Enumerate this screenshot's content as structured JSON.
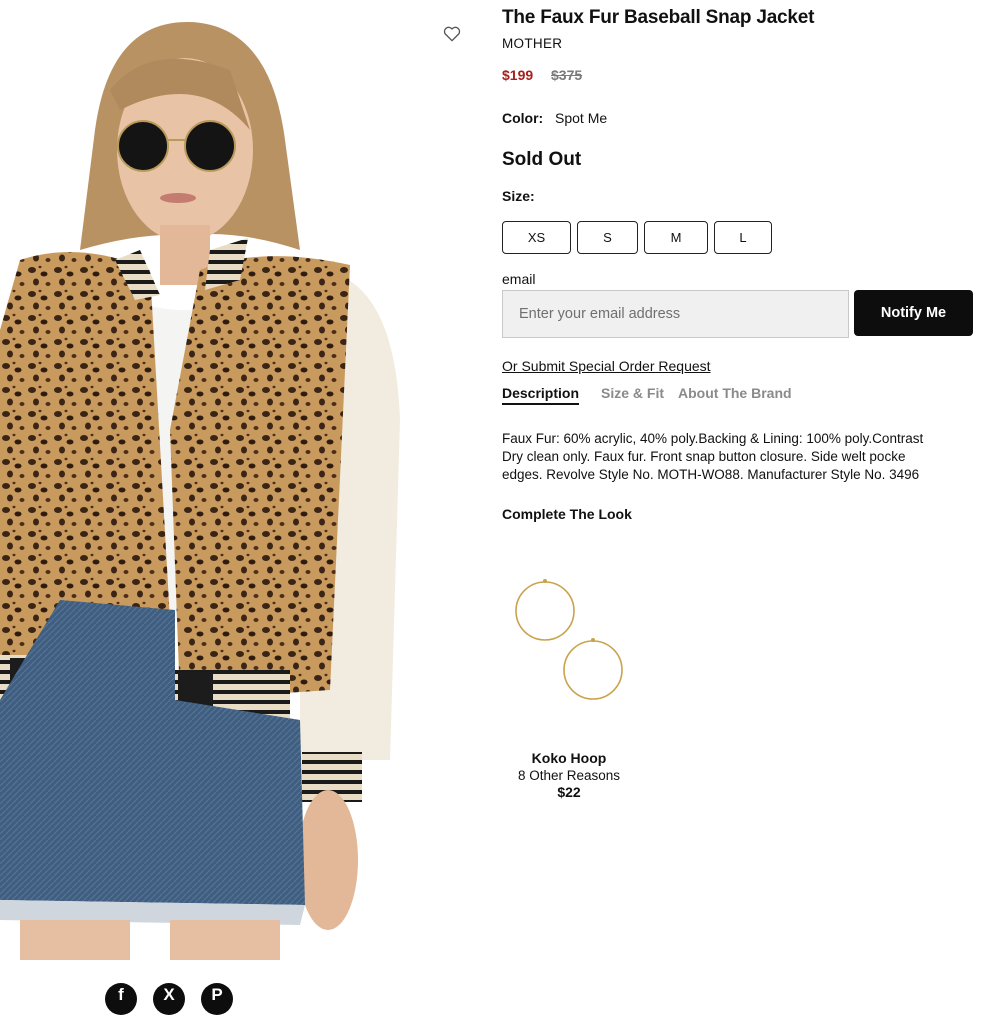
{
  "product": {
    "title": "The Faux Fur Baseball Snap Jacket",
    "brand": "MOTHER",
    "sale_price": "$199",
    "original_price": "$375",
    "color_label": "Color:",
    "color_value": "Spot Me",
    "availability": "Sold Out",
    "size_label": "Size:",
    "sizes": [
      "XS",
      "S",
      "M",
      "L"
    ]
  },
  "notify": {
    "email_label": "email",
    "email_placeholder": "Enter your email address",
    "button_label": "Notify Me"
  },
  "special_order_link": "Or Submit Special Order Request",
  "tabs": [
    "Description",
    "Size & Fit",
    "About The Brand"
  ],
  "active_tab": "Description",
  "description_lines": [
    "Faux Fur: 60% acrylic, 40% poly.Backing & Lining: 100% poly.Contrast",
    "Dry clean only. Faux fur. Front snap button closure. Side welt pocke",
    "edges. Revolve Style No. MOTH-WO88. Manufacturer Style No. 3496"
  ],
  "complete_the_look": {
    "heading": "Complete The Look",
    "items": [
      {
        "name": "Koko Hoop",
        "brand": "8 Other Reasons",
        "price": "$22"
      }
    ]
  },
  "social_share": [
    {
      "icon": "facebook-icon",
      "glyph": "f"
    },
    {
      "icon": "x-twitter-icon",
      "glyph": "X"
    },
    {
      "icon": "pinterest-icon",
      "glyph": "P"
    }
  ],
  "colors": {
    "sale_price": "#a7201c",
    "original_price": "#7a7a7a",
    "button_bg": "#0d0d0d",
    "input_bg": "#f0f0f0",
    "inactive_tab": "#8a8a8a"
  }
}
